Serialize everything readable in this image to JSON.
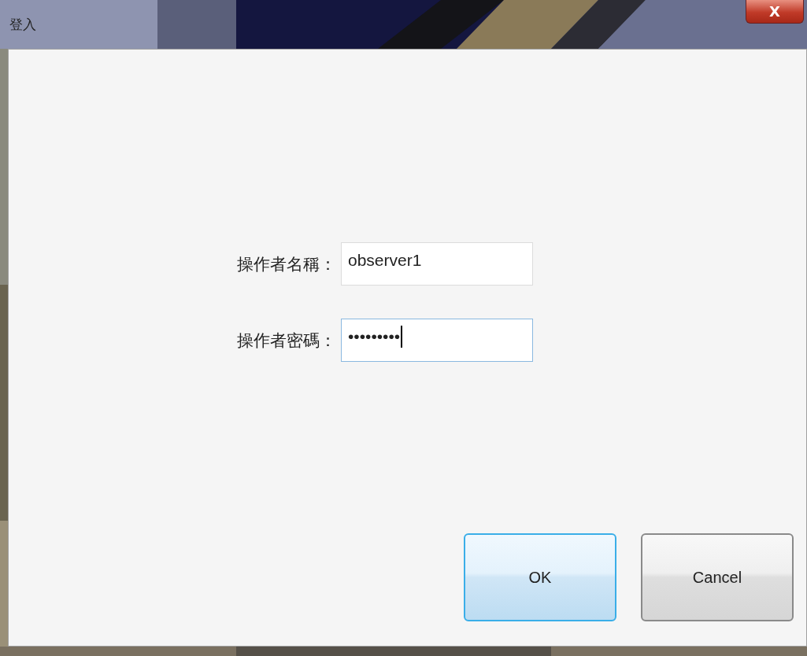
{
  "window": {
    "title": "登入",
    "close_label": "X"
  },
  "fields": [
    {
      "label": "操作者名稱：",
      "value": "observer1",
      "focused": false
    },
    {
      "label": "操作者密碼：",
      "value": "•••••••••",
      "focused": true
    }
  ],
  "buttons": [
    {
      "label": "OK",
      "default": true
    },
    {
      "label": "Cancel",
      "default": false
    }
  ]
}
